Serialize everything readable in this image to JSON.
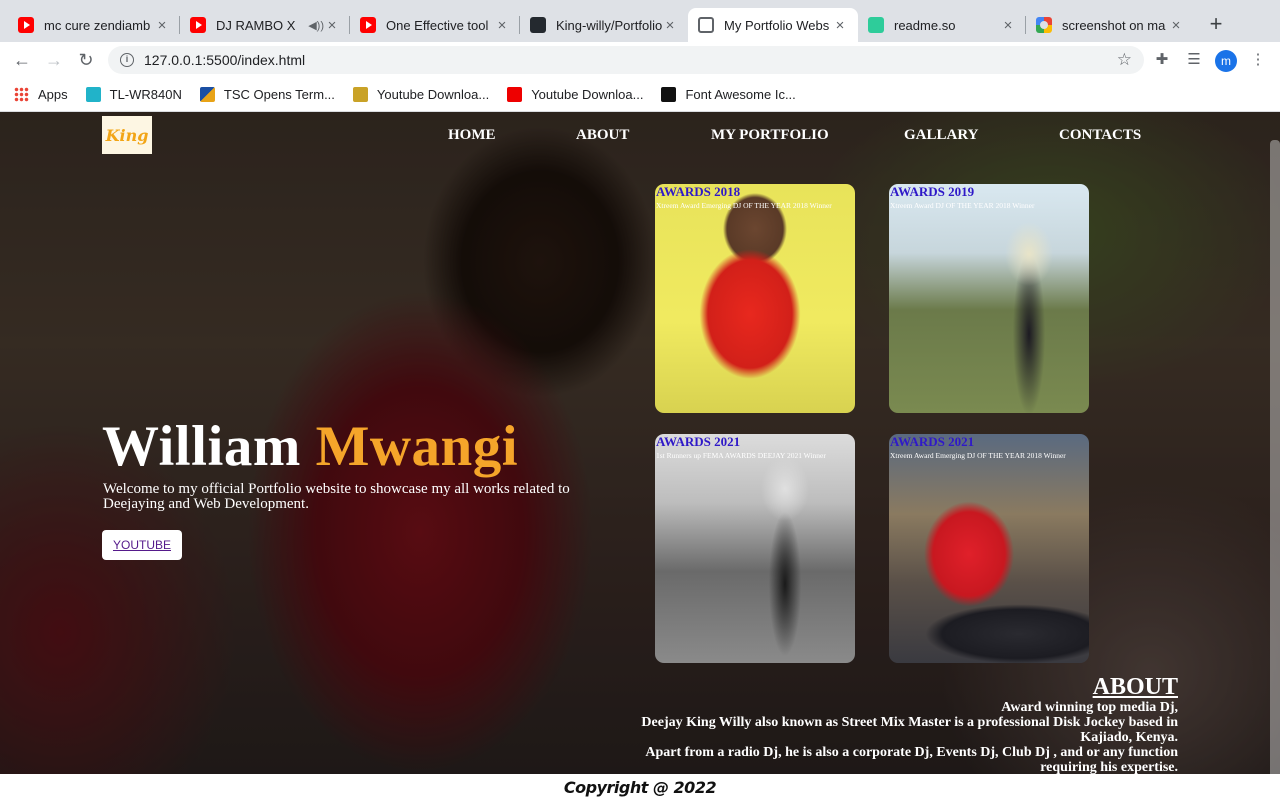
{
  "browser": {
    "tabs": [
      {
        "title": "mc cure zendiamb",
        "icon": "youtube-icon",
        "has_audio": false,
        "active": false
      },
      {
        "title": "DJ RAMBO X",
        "icon": "youtube-icon",
        "has_audio": true,
        "active": false
      },
      {
        "title": "One Effective tool",
        "icon": "youtube-icon",
        "has_audio": false,
        "active": false
      },
      {
        "title": "King-willy/Portfolio",
        "icon": "github-icon",
        "has_audio": false,
        "active": false
      },
      {
        "title": "My Portfolio Webs",
        "icon": "globe-icon",
        "has_audio": false,
        "active": true
      },
      {
        "title": "readme.so",
        "icon": "readme-icon",
        "has_audio": false,
        "active": false
      },
      {
        "title": "screenshot on ma",
        "icon": "google-icon",
        "has_audio": false,
        "active": false
      }
    ],
    "tab_close_glyph": "×",
    "new_tab_glyph": "+",
    "url": "127.0.0.1:5500/index.html",
    "profile_initial": "m",
    "bookmarks": [
      {
        "label": "Apps",
        "icon": "apps-grid-icon"
      },
      {
        "label": "TL-WR840N",
        "icon": "tplink-icon"
      },
      {
        "label": "TSC Opens Term...",
        "icon": "tsc-icon"
      },
      {
        "label": "Youtube Downloa...",
        "icon": "download-icon"
      },
      {
        "label": "Youtube Downloa...",
        "icon": "youtube-download-icon"
      },
      {
        "label": "Font Awesome Ic...",
        "icon": "font-awesome-icon"
      }
    ]
  },
  "site": {
    "logo_text": "King",
    "nav": [
      "HOME",
      "ABOUT",
      "MY PORTFOLIO",
      "GALLARY",
      "CONTACTS"
    ],
    "awards": [
      {
        "title": "AWARDS 2018",
        "desc": "Xtreem Award Emerging DJ OF THE YEAR 2018 Winner"
      },
      {
        "title": "AWARDS 2019",
        "desc": "Xtreem Award DJ OF THE YEAR 2018 Winner"
      },
      {
        "title": "AWARDS 2021",
        "desc": "1st Runners up FEMA AWARDS DEEJAY 2021 Winner"
      },
      {
        "title": "AWARDS 2021",
        "desc": "Xtreem Award Emerging DJ OF THE YEAR 2018 Winner"
      }
    ],
    "hero": {
      "first_name": "William",
      "last_name": "Mwangi",
      "subtitle": "Welcome to my official Portfolio website to showcase my all works related to Deejaying and Web Development.",
      "button_label": "YOUTUBE"
    },
    "about": {
      "heading": "ABOUT",
      "line1": "Award winning top media Dj,",
      "line2": "Deejay King Willy also known as Street Mix Master is a professional Disk Jockey based in Kajiado, Kenya.",
      "line3": "Apart from a radio Dj, he is also a corporate Dj, Events Dj, Club Dj , and or any function requiring his expertise."
    },
    "footer": "Copyright @ 2022",
    "colors": {
      "accent": "#f5a52a",
      "award_title": "#2f19c8",
      "link": "#551a8b"
    }
  }
}
